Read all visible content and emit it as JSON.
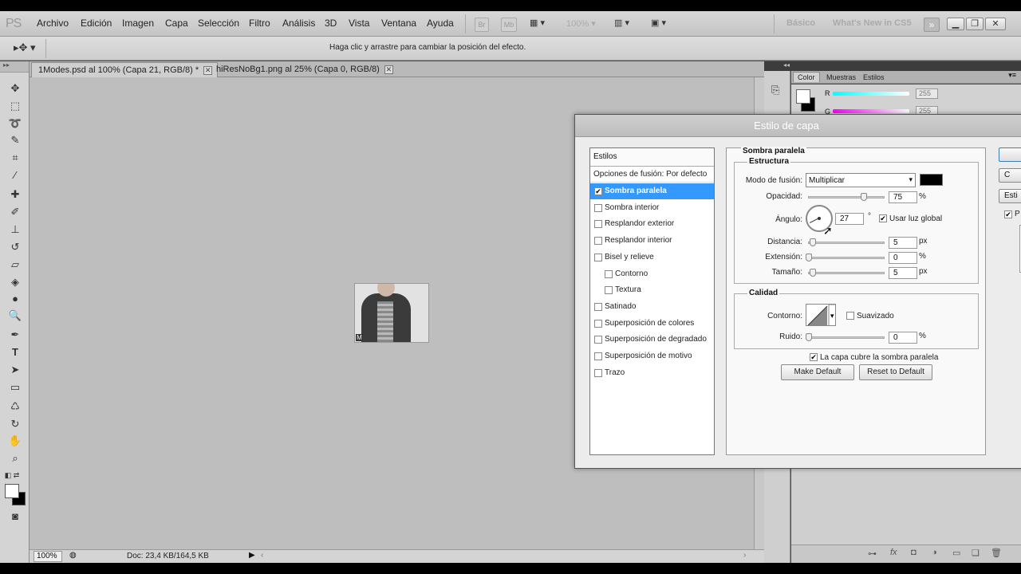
{
  "app": {
    "logo": "PS"
  },
  "menu": [
    "Archivo",
    "Edición",
    "Imagen",
    "Capa",
    "Selección",
    "Filtro",
    "Análisis",
    "3D",
    "Vista",
    "Ventana",
    "Ayuda"
  ],
  "menubar": {
    "br_label": "Br",
    "mb_label": "Mb",
    "zoom": "100%",
    "workspaces": [
      "Básico",
      "What's New in CS5"
    ]
  },
  "options": {
    "hint": "Haga clic y arrastre para cambiar la posición del efecto."
  },
  "tabs": [
    {
      "label": "1Modes.psd al 100% (Capa 21, RGB/8) *",
      "close": "✕"
    },
    {
      "label": "hiResNoBg1.png al 25% (Capa 0, RGB/8)",
      "close": "✕"
    }
  ],
  "status": {
    "zoom": "100%",
    "doc": "Doc: 23,4 KB/164,5 KB"
  },
  "panel": {
    "tabs": [
      "Color",
      "Muestras",
      "Estilos"
    ],
    "channels": [
      {
        "label": "R",
        "value": "255"
      },
      {
        "label": "G",
        "value": "255"
      }
    ]
  },
  "dialog": {
    "title": "Estilo de capa",
    "styles_header": "Estilos",
    "blend_options": "Opciones de fusión: Por defecto",
    "effects": [
      {
        "label": "Sombra paralela",
        "checked": true,
        "selected": true,
        "sub": false
      },
      {
        "label": "Sombra interior",
        "checked": false,
        "selected": false,
        "sub": false
      },
      {
        "label": "Resplandor exterior",
        "checked": false,
        "selected": false,
        "sub": false
      },
      {
        "label": "Resplandor interior",
        "checked": false,
        "selected": false,
        "sub": false
      },
      {
        "label": "Bisel y relieve",
        "checked": false,
        "selected": false,
        "sub": false
      },
      {
        "label": "Contorno",
        "checked": false,
        "selected": false,
        "sub": true
      },
      {
        "label": "Textura",
        "checked": false,
        "selected": false,
        "sub": true
      },
      {
        "label": "Satinado",
        "checked": false,
        "selected": false,
        "sub": false
      },
      {
        "label": "Superposición de colores",
        "checked": false,
        "selected": false,
        "sub": false
      },
      {
        "label": "Superposición de degradado",
        "checked": false,
        "selected": false,
        "sub": false
      },
      {
        "label": "Superposición de motivo",
        "checked": false,
        "selected": false,
        "sub": false
      },
      {
        "label": "Trazo",
        "checked": false,
        "selected": false,
        "sub": false
      }
    ],
    "section_title": "Sombra paralela",
    "structure": {
      "title": "Estructura",
      "blend_label": "Modo de fusión:",
      "blend_value": "Multiplicar",
      "shadow_color": "#000000",
      "opacity_label": "Opacidad:",
      "opacity_value": "75",
      "opacity_unit": "%",
      "opacity_level": 0.75,
      "angle_label": "Ángulo:",
      "angle_value": "27",
      "angle_unit": "°",
      "global_light_label": "Usar luz global",
      "global_light": true,
      "distance_label": "Distancia:",
      "distance_value": "5",
      "distance_unit": "px",
      "spread_label": "Extensión:",
      "spread_value": "0",
      "spread_unit": "%",
      "size_label": "Tamaño:",
      "size_value": "5",
      "size_unit": "px"
    },
    "quality": {
      "title": "Calidad",
      "contour_label": "Contorno:",
      "antialias_label": "Suavizado",
      "noise_label": "Ruido:",
      "noise_value": "0",
      "noise_unit": "%"
    },
    "knockout_label": "La capa cubre la sombra paralela",
    "make_default": "Make Default",
    "reset_default": "Reset to Default",
    "side_buttons": [
      "",
      "C",
      "Esti"
    ],
    "preview_label": "P"
  },
  "colors": {
    "selection": "#3399ff",
    "canvas": "#bebebe",
    "dialog_bg": "#ececec"
  }
}
